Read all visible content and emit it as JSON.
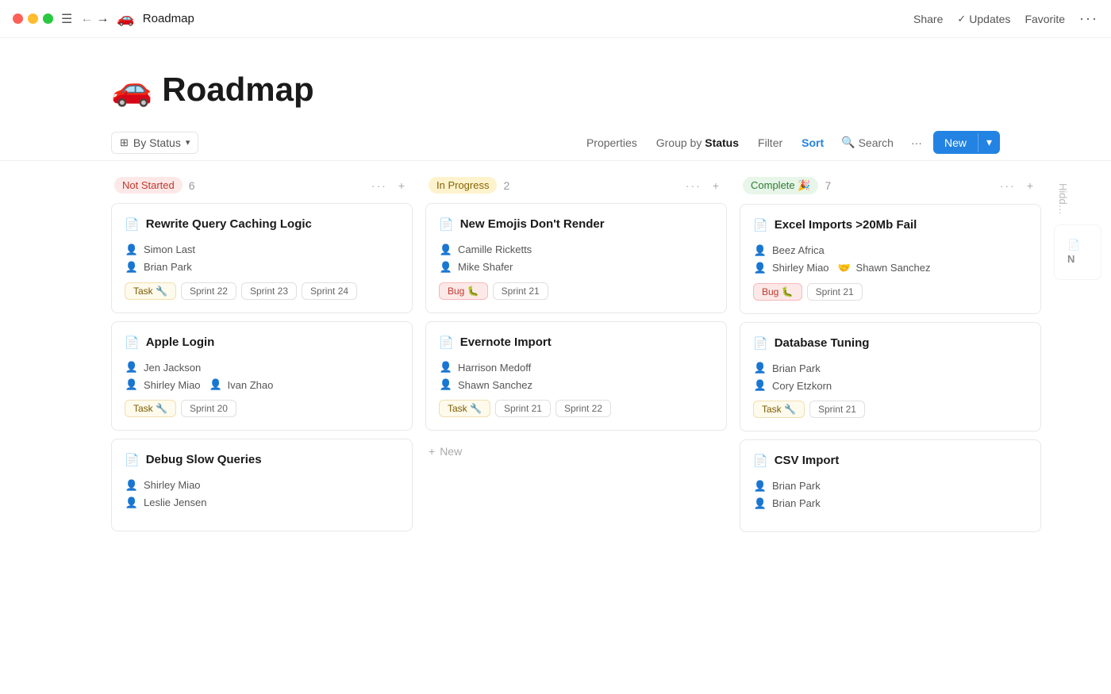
{
  "titlebar": {
    "page_icon": "🚗",
    "page_title": "Roadmap",
    "actions": {
      "share": "Share",
      "updates": "Updates",
      "favorite": "Favorite",
      "more": "···"
    }
  },
  "page": {
    "emoji": "🚗",
    "title": "Roadmap"
  },
  "toolbar": {
    "view_label": "By Status",
    "properties": "Properties",
    "group_by_prefix": "Group by ",
    "group_by_value": "Status",
    "filter": "Filter",
    "sort": "Sort",
    "search": "Search",
    "more": "···",
    "new": "New"
  },
  "columns": [
    {
      "id": "not-started",
      "label": "Not Started",
      "badge_class": "badge-not-started",
      "count": 6,
      "cards": [
        {
          "title": "Rewrite Query Caching Logic",
          "people": [
            {
              "name": "Simon Last",
              "emoji": "👤"
            },
            {
              "name": "Brian Park",
              "emoji": "👤"
            }
          ],
          "tags": [
            {
              "label": "Task 🔧",
              "class": "tag-task"
            }
          ],
          "sprints": [
            "Sprint 22",
            "Sprint 23",
            "Sprint 24"
          ]
        },
        {
          "title": "Apple Login",
          "people": [
            {
              "name": "Jen Jackson",
              "emoji": "👤"
            },
            {
              "name": "Shirley Miao",
              "emoji": "👤",
              "extra": "Ivan Zhao"
            }
          ],
          "tags": [
            {
              "label": "Task 🔧",
              "class": "tag-task"
            }
          ],
          "sprints": [
            "Sprint 20"
          ]
        },
        {
          "title": "Debug Slow Queries",
          "people": [
            {
              "name": "Shirley Miao",
              "emoji": "👤"
            },
            {
              "name": "Leslie Jensen",
              "emoji": "👤"
            }
          ],
          "tags": [],
          "sprints": []
        }
      ]
    },
    {
      "id": "in-progress",
      "label": "In Progress",
      "badge_class": "badge-in-progress",
      "count": 2,
      "cards": [
        {
          "title": "New Emojis Don't Render",
          "people": [
            {
              "name": "Camille Ricketts",
              "emoji": "👤"
            },
            {
              "name": "Mike Shafer",
              "emoji": "👤"
            }
          ],
          "tags": [
            {
              "label": "Bug 🐛",
              "class": "tag-bug"
            }
          ],
          "sprints": [
            "Sprint 21"
          ]
        },
        {
          "title": "Evernote Import",
          "people": [
            {
              "name": "Harrison Medoff",
              "emoji": "👤"
            },
            {
              "name": "Shawn Sanchez",
              "emoji": "👤"
            }
          ],
          "tags": [
            {
              "label": "Task 🔧",
              "class": "tag-task"
            }
          ],
          "sprints": [
            "Sprint 21",
            "Sprint 22"
          ]
        }
      ],
      "new_card_label": "New"
    },
    {
      "id": "complete",
      "label": "Complete 🎉",
      "badge_class": "badge-complete",
      "count": 7,
      "cards": [
        {
          "title": "Excel Imports >20Mb Fail",
          "people": [
            {
              "name": "Beez Africa",
              "emoji": "👤"
            },
            {
              "name": "Shirley Miao",
              "emoji": "👤",
              "extra": "Shawn Sanchez"
            }
          ],
          "tags": [
            {
              "label": "Bug 🐛",
              "class": "tag-bug"
            }
          ],
          "sprints": [
            "Sprint 21"
          ]
        },
        {
          "title": "Database Tuning",
          "people": [
            {
              "name": "Brian Park",
              "emoji": "👤"
            },
            {
              "name": "Cory Etzkorn",
              "emoji": "👤"
            }
          ],
          "tags": [
            {
              "label": "Task 🔧",
              "class": "tag-task"
            }
          ],
          "sprints": [
            "Sprint 21"
          ]
        },
        {
          "title": "CSV Import",
          "people": [
            {
              "name": "Brian Park",
              "emoji": "👤"
            },
            {
              "name": "Brian Park",
              "emoji": "👤"
            }
          ],
          "tags": [],
          "sprints": []
        }
      ]
    }
  ],
  "hidden_column_label": "Hidd…"
}
